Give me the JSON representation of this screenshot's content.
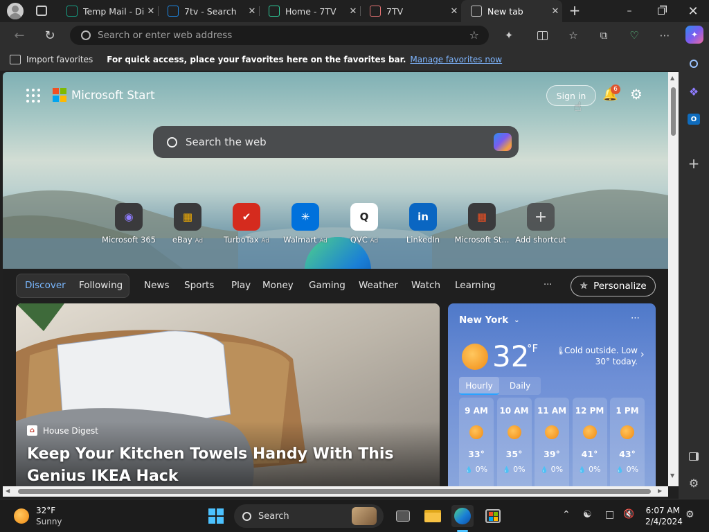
{
  "browser": {
    "tabs": [
      {
        "title": "Temp Mail - Dis",
        "icon": "temp-mail-icon",
        "color": "#16a085"
      },
      {
        "title": "7tv - Search",
        "icon": "search-icon",
        "color": "#1e88e5"
      },
      {
        "title": "Home - 7TV",
        "icon": "7tv-icon",
        "color": "#2ecc9a"
      },
      {
        "title": "7TV",
        "icon": "7tv-page-icon",
        "color": "#e57373"
      },
      {
        "title": "New tab",
        "icon": "new-tab-icon",
        "color": "#cccccc"
      }
    ],
    "address_placeholder": "Search or enter web address",
    "favorites_bar": {
      "import_label": "Import favorites",
      "hint": "For quick access, place your favorites here on the favorites bar.",
      "manage_link": "Manage favorites now"
    }
  },
  "page": {
    "brand": "Microsoft Start",
    "sign_in": "Sign in",
    "notification_count": "6",
    "search_placeholder": "Search the web",
    "shortcuts": [
      {
        "label": "Microsoft 365",
        "ad": "",
        "icon": "microsoft-365-icon",
        "color": "#7b61ff"
      },
      {
        "label": "eBay",
        "ad": "Ad",
        "icon": "ebay-icon",
        "color": "#e53238"
      },
      {
        "label": "TurboTax",
        "ad": "Ad",
        "icon": "turbotax-icon",
        "color": "#d52b1e"
      },
      {
        "label": "Walmart",
        "ad": "Ad",
        "icon": "walmart-icon",
        "color": "#0071dc"
      },
      {
        "label": "QVC",
        "ad": "Ad",
        "icon": "qvc-icon",
        "color": "#ffffff"
      },
      {
        "label": "LinkedIn",
        "ad": "",
        "icon": "linkedin-icon",
        "color": "#0a66c2"
      },
      {
        "label": "Microsoft St...",
        "ad": "",
        "icon": "microsoft-store-icon",
        "color": "#f25022"
      },
      {
        "label": "Add shortcut",
        "ad": "",
        "icon": "plus-icon",
        "color": "#3a3a3c"
      }
    ],
    "nav_tabs": [
      "Discover",
      "Following",
      "News",
      "Sports",
      "Play",
      "Money",
      "Gaming",
      "Weather",
      "Watch",
      "Learning"
    ],
    "more_label": "···",
    "personalize": "Personalize",
    "article": {
      "source": "House Digest",
      "headline": "Keep Your Kitchen Towels Handy With This Genius IKEA Hack"
    },
    "weather": {
      "location": "New York",
      "temp": "32",
      "unit": "°F",
      "note": "Cold outside. Low 30° today.",
      "tabs": [
        "Hourly",
        "Daily"
      ],
      "hourly": [
        {
          "time": "9 AM",
          "temp": "33°",
          "precip": "0%"
        },
        {
          "time": "10 AM",
          "temp": "35°",
          "precip": "0%"
        },
        {
          "time": "11 AM",
          "temp": "39°",
          "precip": "0%"
        },
        {
          "time": "12 PM",
          "temp": "41°",
          "precip": "0%"
        },
        {
          "time": "1 PM",
          "temp": "43°",
          "precip": "0%"
        }
      ]
    }
  },
  "taskbar": {
    "weather_temp": "32°F",
    "weather_desc": "Sunny",
    "search_label": "Search",
    "time": "6:07 AM",
    "date": "2/4/2024"
  }
}
